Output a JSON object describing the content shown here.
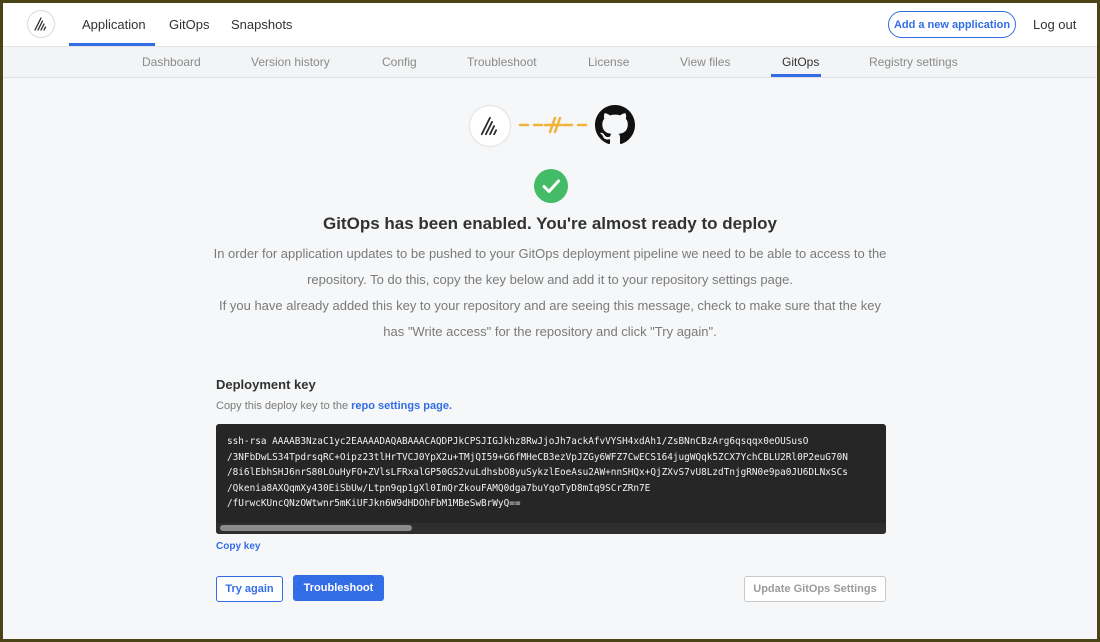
{
  "topbar": {
    "logo_icon": "kots-logo-icon",
    "nav": [
      {
        "label": "Application",
        "active": true
      },
      {
        "label": "GitOps",
        "active": false
      },
      {
        "label": "Snapshots",
        "active": false
      }
    ],
    "add_app_label": "Add a new application",
    "logout_label": "Log out"
  },
  "subnav": {
    "items": [
      {
        "label": "Dashboard",
        "active": false
      },
      {
        "label": "Version history",
        "active": false
      },
      {
        "label": "Config",
        "active": false
      },
      {
        "label": "Troubleshoot",
        "active": false
      },
      {
        "label": "License",
        "active": false
      },
      {
        "label": "View files",
        "active": false
      },
      {
        "label": "GitOps",
        "active": true
      },
      {
        "label": "Registry settings",
        "active": false
      }
    ]
  },
  "connection": {
    "left_icon": "kots-logo-icon",
    "middle_icon": "broken-link-icon",
    "right_icon": "github-icon",
    "status_icon": "check-circle-icon"
  },
  "main": {
    "title": "GitOps has been enabled. You're almost ready to deploy",
    "paragraph1": "In order for application updates to be pushed to your GitOps deployment pipeline we need to be able to access to the repository. To do this, copy the key below and add it to your repository settings page.",
    "paragraph2": "If you have already added this key to your repository and are seeing this message, check to make sure that the key has \"Write access\" for the repository and click \"Try again\"."
  },
  "deploy_key": {
    "label": "Deployment key",
    "subtext": "Copy this deploy key to the ",
    "link_text": "repo settings page.",
    "key_lines": "ssh-rsa AAAAB3NzaC1yc2EAAAADAQABAAACAQDPJkCPSJIGJkhz8RwJjoJh7ackAfvVYSH4xdAh1/ZsBNnCBzArg6qsqqx0eOUSusO\n/3NFbDwLS34TpdrsqRC+Oipz23tlHrTVCJ0YpX2u+TMjQI59+G6fMHeCB3ezVpJZGy6WFZ7CwECS164jugWQqk5ZCX7YchCBLU2Rl0P2euG70N\n/8i6lEbhSHJ6nrS80LOuHyFO+ZVlsLFRxalGP50GS2vuLdhsbO8yuSykzlEoeAsu2AW+nnSHQx+QjZXvS7vU8LzdTnjgRN0e9pa0JU6DLNxSCs\n/Qkenia8AXQqmXy430EiSbUw/Ltpn9qp1gXl0ImQrZkouFAMQ0dga7buYqoTyD8mIq9SCrZRn7E\n/fUrwcKUncQNzOWtwnr5mKiUFJkn6W9dHDOhFbM1MBeSwBrWyQ==",
    "copy_label": "Copy key"
  },
  "actions": {
    "try_again_label": "Try again",
    "troubleshoot_label": "Troubleshoot",
    "update_label": "Update GitOps Settings"
  },
  "colors": {
    "accent": "#326de6",
    "success": "#44bb66",
    "link_orange": "#f0b43c"
  }
}
